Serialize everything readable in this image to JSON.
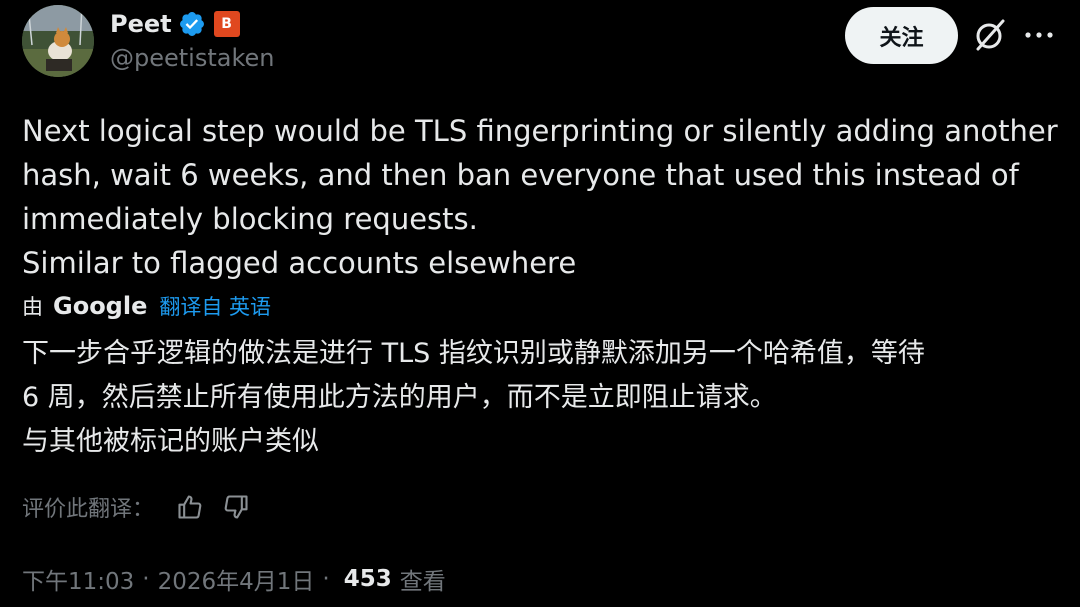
{
  "author": {
    "name": "Peet",
    "handle": "@peetistaken",
    "badge_letter": "B",
    "verified_color": "#1d9bf0",
    "badge_color": "#e0481f"
  },
  "actions": {
    "follow_label": "关注",
    "grok_icon": "grok-icon",
    "more_icon": "more-icon"
  },
  "tweet": {
    "text": "Next logical step would be TLS fingerprinting or silently adding another\nhash, wait 6 weeks, and then ban everyone that used this instead of\nimmediately blocking requests.\nSimilar to flagged accounts elsewhere"
  },
  "translation": {
    "by_label": "由",
    "provider": "Google",
    "link_label": "翻译自 英语",
    "text": "下一步合乎逻辑的做法是进行 TLS 指纹识别或静默添加另一个哈希值，等待\n6 周，然后禁止所有使用此方法的用户，而不是立即阻止请求。\n与其他被标记的账户类似",
    "rate_label": "评价此翻译："
  },
  "meta": {
    "time": "下午11:03",
    "separator": "·",
    "date": "2026年4月1日",
    "views_count": "453",
    "views_label": "查看"
  },
  "colors": {
    "background": "#000000",
    "text": "#e7e9ea",
    "secondary": "#71767b",
    "link": "#1d9bf0"
  }
}
